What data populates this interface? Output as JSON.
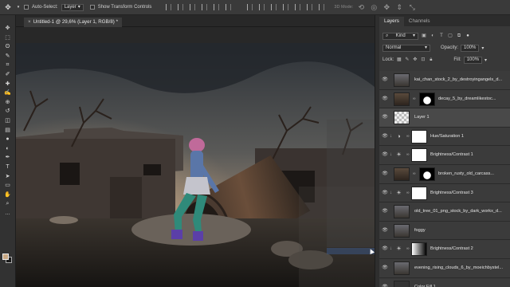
{
  "options_bar": {
    "auto_select_label": "Auto-Select:",
    "auto_select_value": "Layer",
    "transform_label": "Show Transform Controls",
    "mode_3d_label": "3D Mode:"
  },
  "document": {
    "tab_title": "Untitled-1 @ 29,6% (Layer 1, RGB/8) *",
    "close_glyph": "×"
  },
  "toolbar": {
    "tools": [
      "move-icon",
      "marquee-icon",
      "lasso-icon",
      "quick-select-icon",
      "crop-icon",
      "eyedropper-icon",
      "healing-icon",
      "brush-icon",
      "clone-stamp-icon",
      "history-brush-icon",
      "eraser-icon",
      "gradient-icon",
      "blur-icon",
      "dodge-icon",
      "pen-icon",
      "type-icon",
      "path-select-icon",
      "shape-icon",
      "hand-icon",
      "zoom-icon",
      "more-icon"
    ],
    "glyphs": [
      "✥",
      "⬚",
      "ʘ",
      "✎",
      "⌗",
      "✐",
      "✚",
      "✍",
      "⊕",
      "↺",
      "◫",
      "▤",
      "●",
      "◐",
      "✒",
      "T",
      "➤",
      "▭",
      "✋",
      "⌕",
      "…"
    ],
    "foreground_color": "#c8a884",
    "background_color": "#1a1a1a"
  },
  "panel": {
    "tabs": [
      "Layers",
      "Channels"
    ],
    "kind_label": "Kind",
    "blend_mode": "Normal",
    "opacity_label": "Opacity:",
    "opacity_value": "100%",
    "lock_label": "Lock:",
    "fill_label": "Fill:",
    "fill_value": "100%"
  },
  "layers": [
    {
      "name": "kai_chan_stock_2_by_destroyingangels_d...",
      "type": "image",
      "selected": false
    },
    {
      "name": "decay_5_by_dreamlikestoc...",
      "type": "image_mask",
      "selected": false
    },
    {
      "name": "Layer 1",
      "type": "empty",
      "selected": true
    },
    {
      "name": "Hue/Saturation 1",
      "type": "adjustment",
      "icon": "hue-saturation-icon",
      "selected": false
    },
    {
      "name": "Brightness/Contrast 1",
      "type": "adjustment",
      "icon": "brightness-contrast-icon",
      "selected": false
    },
    {
      "name": "broken_rusty_old_carcass...",
      "type": "image_mask",
      "selected": false
    },
    {
      "name": "Brightness/Contrast 3",
      "type": "adjustment",
      "icon": "brightness-contrast-icon",
      "selected": false
    },
    {
      "name": "old_tree_01_png_stock_by_dark_workx_d...",
      "type": "image",
      "selected": false
    },
    {
      "name": "foggy",
      "type": "image",
      "selected": false
    },
    {
      "name": "Brightness/Contrast 2",
      "type": "adjustment",
      "icon": "brightness-contrast-icon",
      "selected": false
    },
    {
      "name": "evening_rising_clouds_6_by_moeichbystel...",
      "type": "image",
      "selected": false
    },
    {
      "name": "Color Fill 1",
      "type": "fill",
      "selected": false
    }
  ]
}
